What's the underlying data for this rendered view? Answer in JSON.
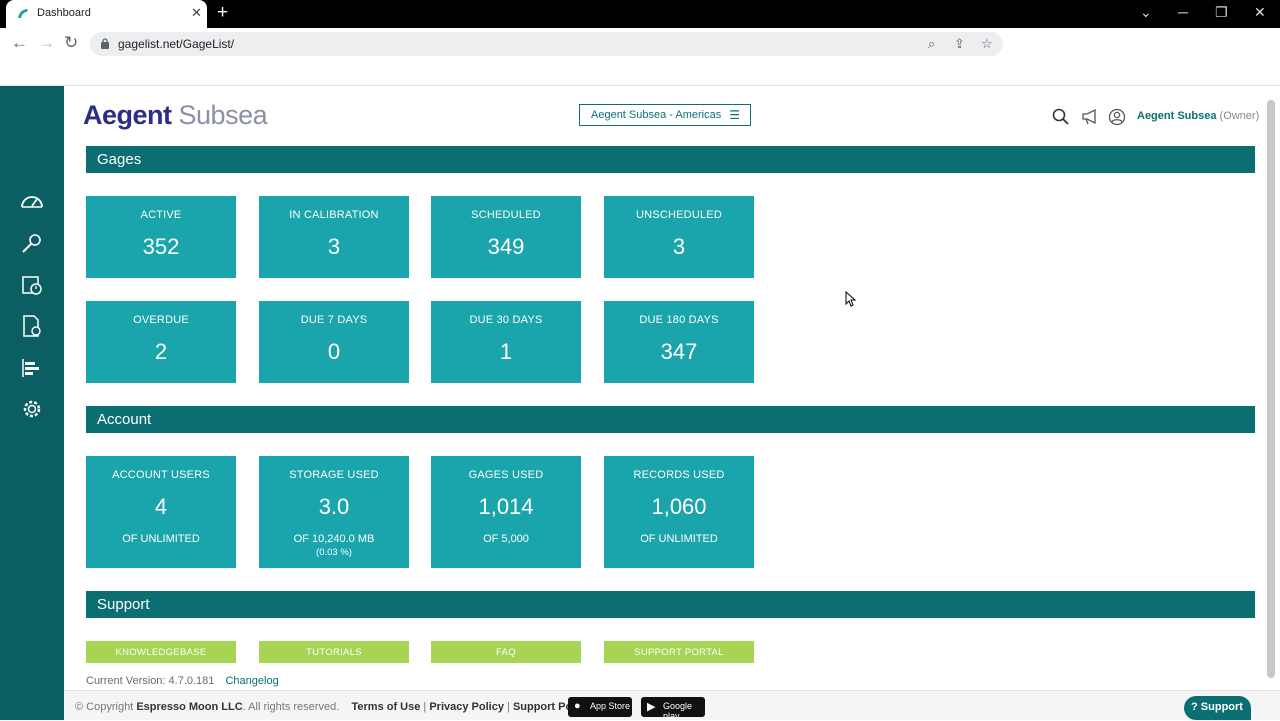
{
  "browser": {
    "tab_title": "Dashboard",
    "new_tab": "+",
    "url": "gagelist.net/GageList/"
  },
  "app": {
    "logo_primary": "Aegent",
    "logo_secondary": "Subsea",
    "region_selector": "Aegent Subsea - Americas",
    "user_name": "Aegent Subsea",
    "user_role": "(Owner)",
    "accent_color": "#0b6e73",
    "tile_color": "#1aa4ab",
    "button_color": "#a6d453"
  },
  "sidebar": {
    "items": [
      {
        "icon": "dashboard-gauge-icon"
      },
      {
        "icon": "gage-tool-icon"
      },
      {
        "icon": "calibration-schedule-icon"
      },
      {
        "icon": "records-document-icon"
      },
      {
        "icon": "reports-icon"
      },
      {
        "icon": "settings-gear-icon"
      }
    ]
  },
  "gages": {
    "title": "Gages",
    "tiles": [
      {
        "label": "ACTIVE",
        "value": "352"
      },
      {
        "label": "IN CALIBRATION",
        "value": "3"
      },
      {
        "label": "SCHEDULED",
        "value": "349"
      },
      {
        "label": "UNSCHEDULED",
        "value": "3"
      },
      {
        "label": "OVERDUE",
        "value": "2"
      },
      {
        "label": "DUE 7 DAYS",
        "value": "0"
      },
      {
        "label": "DUE 30 DAYS",
        "value": "1"
      },
      {
        "label": "DUE 180 DAYS",
        "value": "347"
      }
    ]
  },
  "account": {
    "title": "Account",
    "tiles": [
      {
        "label": "ACCOUNT USERS",
        "value": "4",
        "sub": "OF UNLIMITED"
      },
      {
        "label": "STORAGE USED",
        "value": "3.0",
        "sub": "OF 10,240.0 MB",
        "sub2": "(0.03 %)"
      },
      {
        "label": "GAGES USED",
        "value": "1,014",
        "sub": "OF 5,000"
      },
      {
        "label": "RECORDS USED",
        "value": "1,060",
        "sub": "OF UNLIMITED"
      }
    ]
  },
  "support": {
    "title": "Support",
    "buttons": [
      "KNOWLEDGEBASE",
      "TUTORIALS",
      "FAQ",
      "SUPPORT PORTAL"
    ]
  },
  "version": {
    "text": "Current Version: 4.7.0.181",
    "changelog": "Changelog"
  },
  "footer": {
    "copyright_prefix": "© Copyright",
    "company": "Espresso Moon LLC",
    "rights": ". All rights reserved.",
    "terms": "Terms of Use",
    "privacy": "Privacy Policy",
    "support_portal": "Support Portal",
    "sep": "|",
    "app_store": "App Store",
    "google_play": "Google play",
    "support_button": "Support"
  }
}
